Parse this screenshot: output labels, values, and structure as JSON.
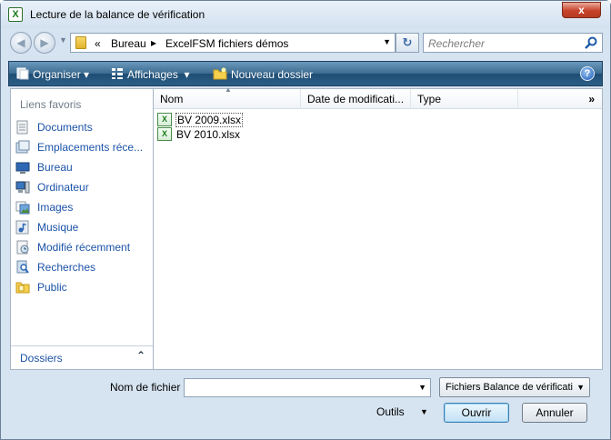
{
  "window": {
    "title": "Lecture de la balance de vérification",
    "app_icon": "excel-icon",
    "close_label": "x"
  },
  "navigation": {
    "breadcrumb_prefix": "«",
    "breadcrumb": [
      "Bureau",
      "ExcelFSM fichiers démos"
    ],
    "search_placeholder": "Rechercher"
  },
  "toolbar": {
    "organise_label": "Organiser",
    "views_label": "Affichages",
    "new_folder_label": "Nouveau dossier"
  },
  "sidebar": {
    "header": "Liens favoris",
    "items": [
      {
        "label": "Documents",
        "icon": "documents-icon"
      },
      {
        "label": "Emplacements réce...",
        "icon": "recent-places-icon"
      },
      {
        "label": "Bureau",
        "icon": "desktop-icon"
      },
      {
        "label": "Ordinateur",
        "icon": "computer-icon"
      },
      {
        "label": "Images",
        "icon": "pictures-icon"
      },
      {
        "label": "Musique",
        "icon": "music-icon"
      },
      {
        "label": "Modifié récemment",
        "icon": "recently-changed-icon"
      },
      {
        "label": "Recherches",
        "icon": "searches-icon"
      },
      {
        "label": "Public",
        "icon": "public-folder-icon"
      }
    ],
    "folders_label": "Dossiers"
  },
  "file_list": {
    "columns": [
      "Nom",
      "Date de modificati...",
      "Type"
    ],
    "more_columns": "»",
    "files": [
      {
        "name": "BV 2009.xlsx",
        "icon": "excel-file-icon",
        "selected": true
      },
      {
        "name": "BV 2010.xlsx",
        "icon": "excel-file-icon",
        "selected": false
      }
    ]
  },
  "footer": {
    "filename_label": "Nom de fichier :",
    "filename_value": "",
    "filter_value": "Fichiers Balance de vérificatio",
    "tools_label": "Outils",
    "open_label": "Ouvrir",
    "cancel_label": "Annuler"
  },
  "colors": {
    "link": "#1c53a8",
    "toolbar": "#2c5f86",
    "close": "#c8422a"
  }
}
